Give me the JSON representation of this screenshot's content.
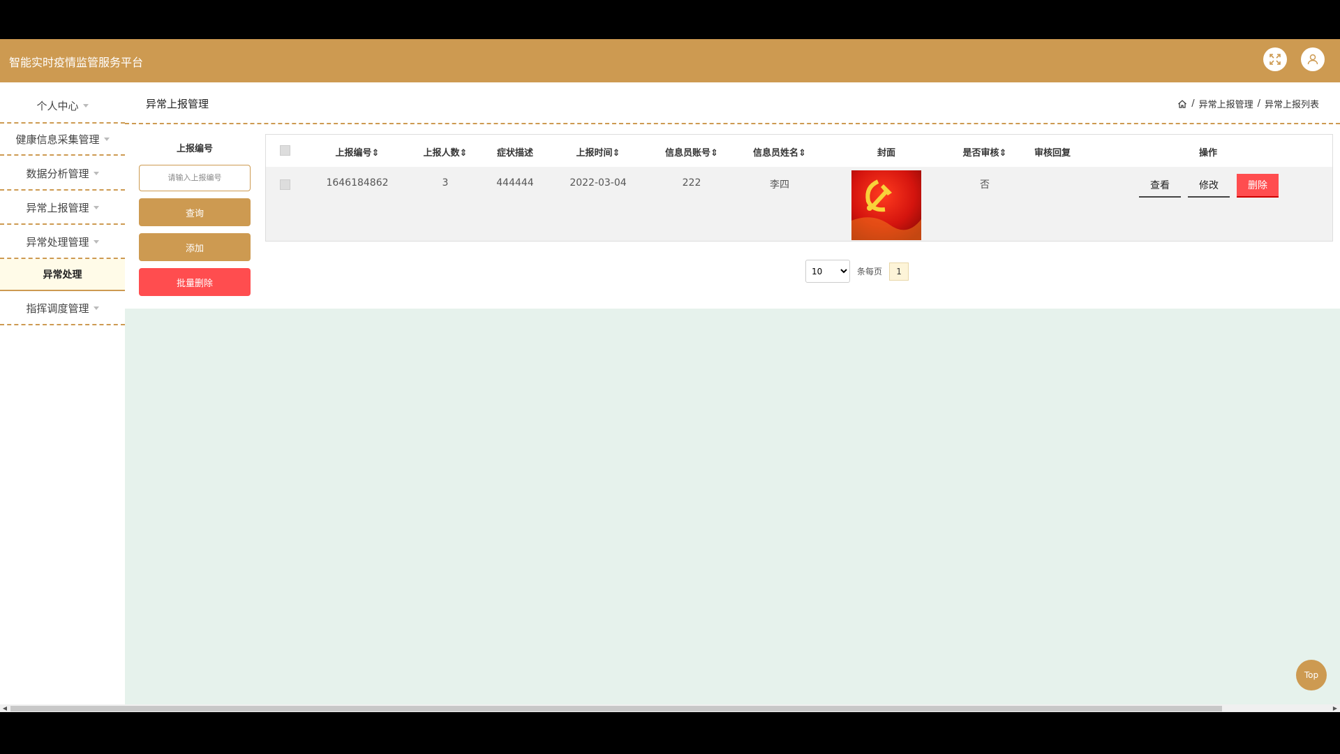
{
  "header": {
    "app_title": "智能实时疫情监管服务平台"
  },
  "sidebar": {
    "items": [
      {
        "label": "个人中心"
      },
      {
        "label": "健康信息采集管理"
      },
      {
        "label": "数据分析管理"
      },
      {
        "label": "异常上报管理"
      },
      {
        "label": "异常处理管理"
      },
      {
        "label": "指挥调度管理"
      }
    ],
    "active_sub": "异常处理"
  },
  "page": {
    "title": "异常上报管理",
    "breadcrumb": [
      "异常上报管理",
      "异常上报列表"
    ]
  },
  "search": {
    "label": "上报编号",
    "placeholder": "请输入上报编号",
    "query_label": "查询",
    "add_label": "添加",
    "batch_delete_label": "批量删除"
  },
  "table": {
    "columns": [
      "上报编号",
      "上报人数",
      "症状描述",
      "上报时间",
      "信息员账号",
      "信息员姓名",
      "封面",
      "是否审核",
      "审核回复",
      "操作"
    ],
    "sort_glyph": "⇕",
    "rows": [
      {
        "report_no": "1646184862",
        "count": "3",
        "symptom": "444444",
        "time": "2022-03-04",
        "account": "222",
        "name": "李四",
        "cover": "red-flag-image",
        "reviewed": "否",
        "reply": "",
        "actions": {
          "view": "查看",
          "edit": "修改",
          "delete": "删除"
        }
      }
    ]
  },
  "pagination": {
    "page_size": "10",
    "page_size_options": [
      "10"
    ],
    "per_page_label": "条每页",
    "current_page": "1"
  },
  "top_button": "Top",
  "colors": {
    "accent": "#cd9a51",
    "danger": "#ff4d4f",
    "content_bg": "#e6f2ec"
  }
}
